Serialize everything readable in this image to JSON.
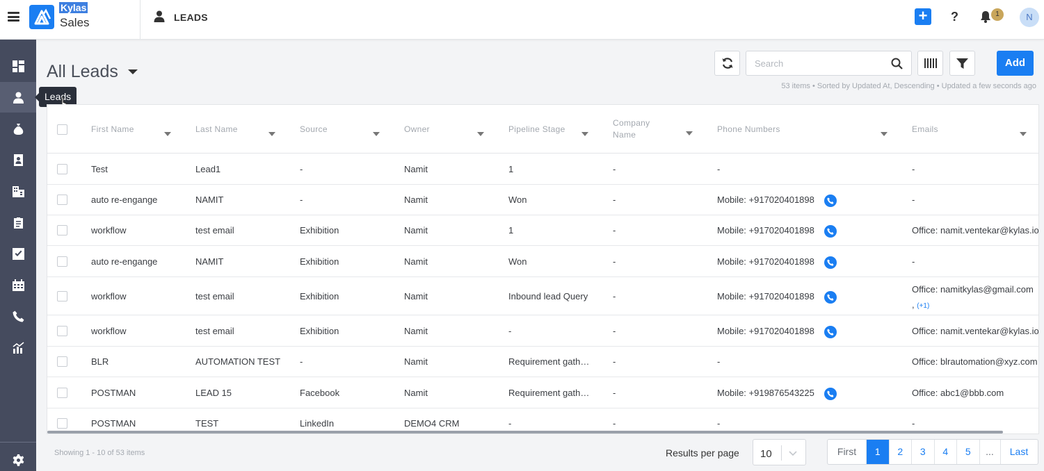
{
  "app": {
    "brand_top": "Kylas",
    "brand_bottom": "Sales",
    "module_title": "LEADS",
    "notification_count": "1",
    "avatar_initial": "N"
  },
  "sidebar": {
    "items": [
      {
        "icon": "dashboard-icon"
      },
      {
        "icon": "person-icon",
        "active": true
      },
      {
        "icon": "money-bag-icon"
      },
      {
        "icon": "contact-card-icon"
      },
      {
        "icon": "building-icon"
      },
      {
        "icon": "clipboard-icon"
      },
      {
        "icon": "checkbox-icon"
      },
      {
        "icon": "calendar-icon"
      },
      {
        "icon": "phone-icon"
      },
      {
        "icon": "report-chart-icon"
      }
    ],
    "settings_icon": "gear-icon",
    "tooltip": "Leads"
  },
  "toolbar": {
    "view_title": "All Leads",
    "search_placeholder": "Search",
    "add_label": "Add",
    "meta": "53 items • Sorted by Updated At, Descending • Updated a few seconds ago"
  },
  "table": {
    "headers": {
      "first_name": "First Name",
      "last_name": "Last Name",
      "source": "Source",
      "owner": "Owner",
      "pipeline_stage": "Pipeline Stage",
      "company_name_1": "Company",
      "company_name_2": "Name",
      "phone_numbers": "Phone Numbers",
      "emails": "Emails"
    },
    "rows": [
      {
        "first": "Test",
        "last": "Lead1",
        "source": "-",
        "owner": "Namit",
        "stage": "1",
        "company": "-",
        "phone": "-",
        "email": "-",
        "email_more": ""
      },
      {
        "first": "auto re-engange",
        "last": "NAMIT",
        "source": "-",
        "owner": "Namit",
        "stage": "Won",
        "company": "-",
        "phone": "Mobile: +917020401898",
        "email": "-",
        "email_more": ""
      },
      {
        "first": "workflow",
        "last": "test email",
        "source": "Exhibition",
        "owner": "Namit",
        "stage": "1",
        "company": "-",
        "phone": "Mobile: +917020401898",
        "email": "Office: namit.ventekar@kylas.io",
        "email_more": ""
      },
      {
        "first": "auto re-engange",
        "last": "NAMIT",
        "source": "Exhibition",
        "owner": "Namit",
        "stage": "Won",
        "company": "-",
        "phone": "Mobile: +917020401898",
        "email": "-",
        "email_more": ""
      },
      {
        "first": "workflow",
        "last": "test email",
        "source": "Exhibition",
        "owner": "Namit",
        "stage": "Inbound lead Query",
        "company": "-",
        "phone": "Mobile: +917020401898",
        "email": "Office: namitkylas@gmail.com",
        "email_more": "(+1)"
      },
      {
        "first": "workflow",
        "last": "test email",
        "source": "Exhibition",
        "owner": "Namit",
        "stage": "-",
        "company": "-",
        "phone": "Mobile: +917020401898",
        "email": "Office: namit.ventekar@kylas.io",
        "email_more": ""
      },
      {
        "first": "BLR",
        "last": "AUTOMATION TEST",
        "source": "-",
        "owner": "Namit",
        "stage": "Requirement gathering",
        "company": "-",
        "phone": "-",
        "email": "Office: blrautomation@xyz.com",
        "email_more": ""
      },
      {
        "first": "POSTMAN",
        "last": "LEAD 15",
        "source": "Facebook",
        "owner": "Namit",
        "stage": "Requirement gathering",
        "company": "-",
        "phone": "Mobile: +919876543225",
        "email": "Office: abc1@bbb.com",
        "email_more": ""
      },
      {
        "first": "POSTMAN",
        "last": "TEST",
        "source": "LinkedIn",
        "owner": "DEMO4 CRM",
        "stage": "-",
        "company": "-",
        "phone": "-",
        "email": "-",
        "email_more": ""
      }
    ]
  },
  "footer": {
    "showing": "Showing 1 - 10 of 53 items",
    "rpp_label": "Results per page",
    "rpp_value": "10",
    "pager": {
      "first": "First",
      "pages": [
        "1",
        "2",
        "3",
        "4",
        "5"
      ],
      "current": "1",
      "ellipsis": "...",
      "last": "Last"
    }
  }
}
